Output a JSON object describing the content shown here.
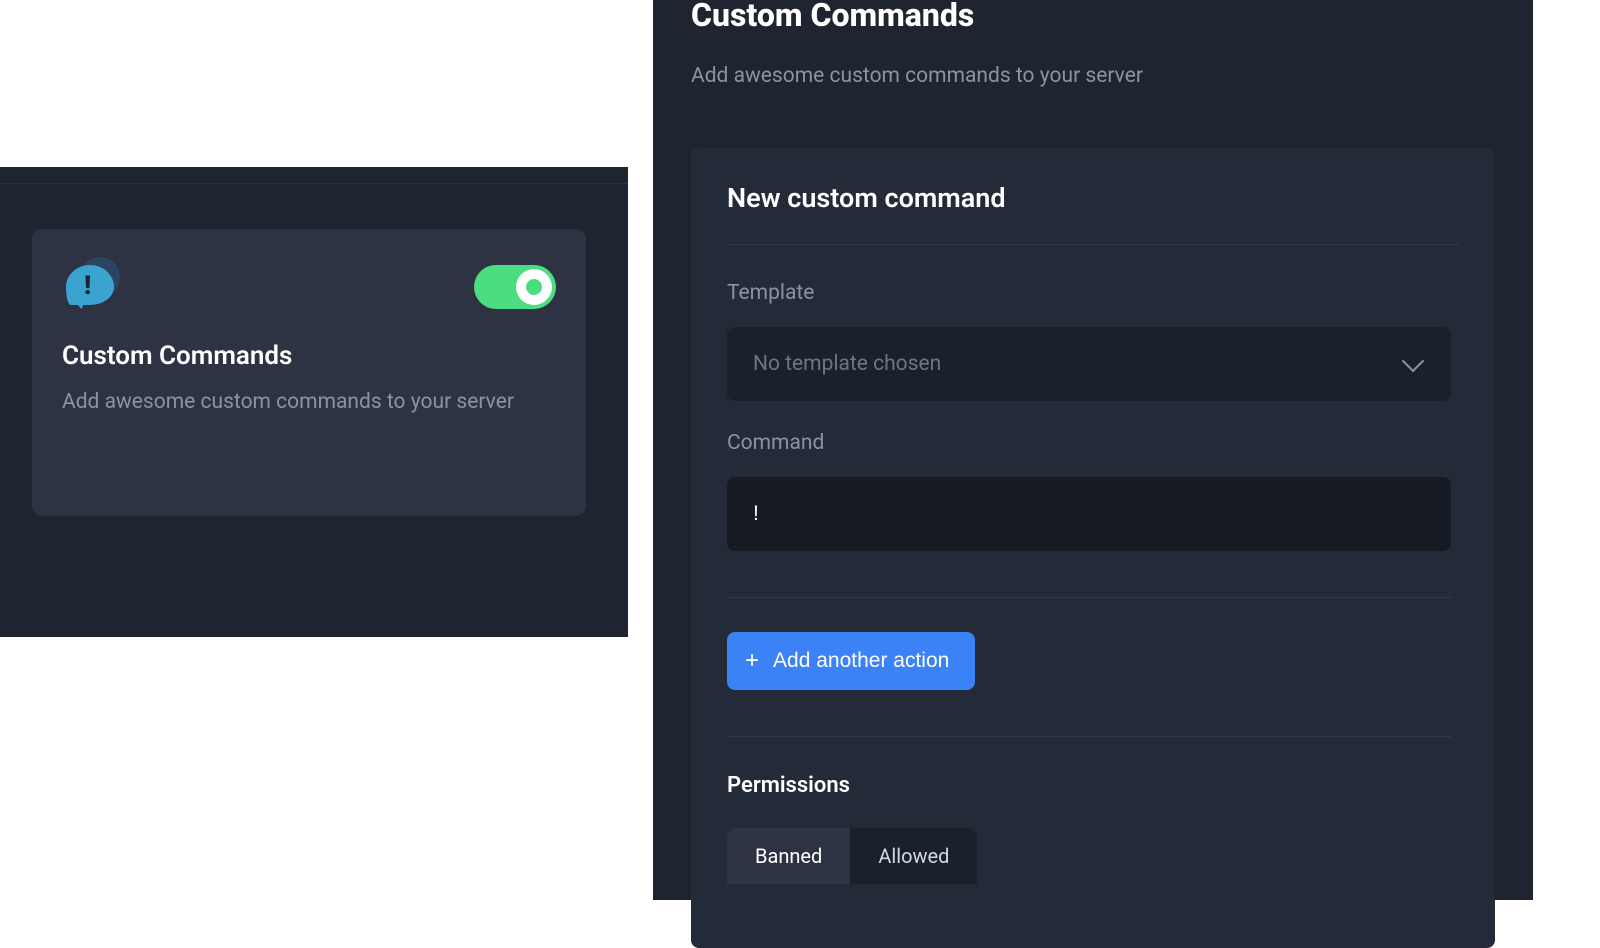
{
  "left_card": {
    "title": "Custom Commands",
    "subtitle": "Add awesome custom commands to your server",
    "toggle_on": true
  },
  "right": {
    "title": "Custom Commands",
    "subtitle": "Add awesome custom commands to your server",
    "form_title": "New custom command",
    "template": {
      "label": "Template",
      "placeholder": "No template chosen"
    },
    "command": {
      "label": "Command",
      "value": "!"
    },
    "add_action_label": "Add another action",
    "permissions": {
      "title": "Permissions",
      "tabs": [
        "Banned",
        "Allowed"
      ],
      "active_index": 0
    }
  }
}
